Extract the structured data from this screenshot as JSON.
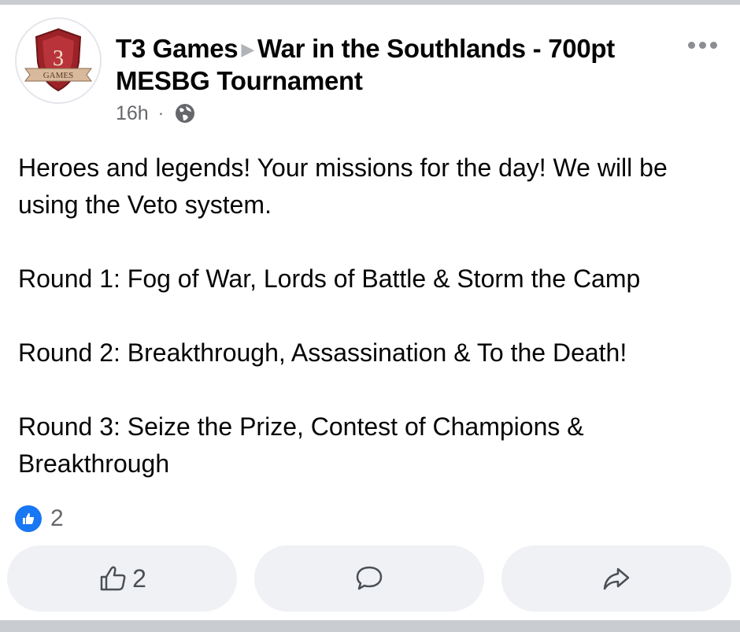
{
  "post": {
    "author": "T3 Games",
    "group": "War in the Southlands - 700pt MESBG Tournament",
    "time": "16h",
    "avatar": {
      "logo_number": "3",
      "logo_banner": "GAMES",
      "colors": {
        "shield": "#9b2226",
        "ribbon": "#d9b99b"
      }
    },
    "body": {
      "p1": "Heroes and legends! Your missions for the day! We will be using the Veto system.",
      "p2": "Round 1: Fog of War, Lords of Battle & Storm the Camp",
      "p3": "Round 2: Breakthrough, Assassination & To the Death!",
      "p4": "Round 3: Seize the Prize, Contest of Champions & Breakthrough"
    }
  },
  "reactions": {
    "count": "2",
    "icon": "like-reaction-icon",
    "color": "#1877f2"
  },
  "actions": {
    "like_count": "2",
    "like_icon": "thumbs-up-outline-icon",
    "comment_icon": "comment-bubble-icon",
    "share_icon": "share-arrow-icon"
  },
  "header": {
    "more_icon": "more-options-icon",
    "privacy_icon": "globe-icon"
  }
}
